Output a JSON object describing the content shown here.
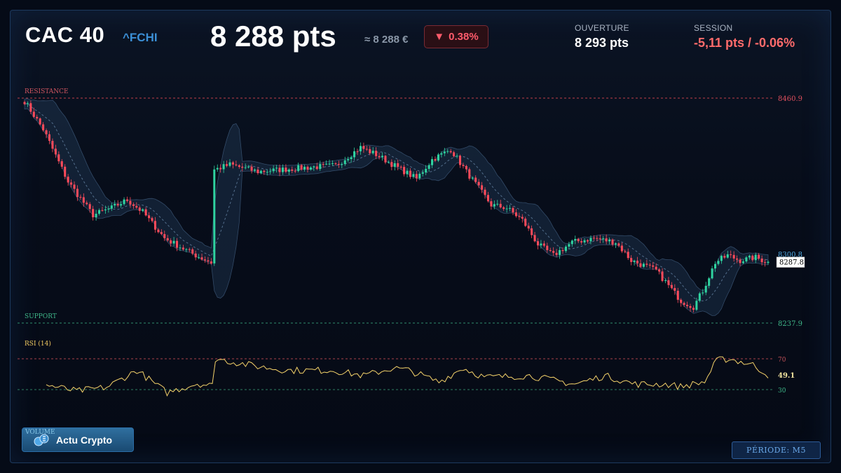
{
  "header": {
    "ticker": "CAC 40",
    "symbol": "^FCHI",
    "price": "8 288 pts",
    "price_eur": "≈ 8 288 €",
    "change_arrow": "▼",
    "change_pct": "0.38%",
    "open_label": "OUVERTURE",
    "open_value": "8 293 pts",
    "session_label": "SESSION",
    "session_value": "-5,11 pts / -0.06%"
  },
  "footer": {
    "volume_label": "VOLUME",
    "crypto_button": "Actu Crypto",
    "period": "PÉRIODE: M5"
  },
  "colors": {
    "up": "#2fd3a0",
    "down": "#ff4a5a",
    "rsi": "#f5d36a",
    "resistance": "#c0404a",
    "support": "#2e8f6e",
    "accent": "#3b8fd6"
  },
  "icons": {
    "crypto": "crypto-coins-icon"
  },
  "chart_data": {
    "type": "candlestick",
    "levels": {
      "resistance_label": "RESISTANCE",
      "resistance": 8460.9,
      "resistance_text": "8460.9",
      "support_label": "SUPPORT",
      "support": 8237.9,
      "support_text": "8237.9",
      "band_upper_text": "8300.8",
      "last_text": "8287.8"
    },
    "ylim": [
      8237.9,
      8460.9
    ],
    "price_path": [
      [
        0,
        8458
      ],
      [
        6,
        8430
      ],
      [
        14,
        8378
      ],
      [
        22,
        8345
      ],
      [
        28,
        8352
      ],
      [
        33,
        8360
      ],
      [
        38,
        8348
      ],
      [
        45,
        8322
      ],
      [
        55,
        8305
      ],
      [
        60,
        8298
      ],
      [
        61,
        8390
      ],
      [
        66,
        8395
      ],
      [
        75,
        8388
      ],
      [
        90,
        8392
      ],
      [
        100,
        8394
      ],
      [
        108,
        8412
      ],
      [
        113,
        8405
      ],
      [
        120,
        8392
      ],
      [
        126,
        8381
      ],
      [
        131,
        8400
      ],
      [
        137,
        8410
      ],
      [
        142,
        8388
      ],
      [
        150,
        8355
      ],
      [
        155,
        8352
      ],
      [
        160,
        8340
      ],
      [
        165,
        8316
      ],
      [
        170,
        8305
      ],
      [
        176,
        8318
      ],
      [
        183,
        8322
      ],
      [
        190,
        8318
      ],
      [
        195,
        8300
      ],
      [
        203,
        8290
      ],
      [
        211,
        8260
      ],
      [
        215,
        8254
      ],
      [
        218,
        8270
      ],
      [
        222,
        8298
      ],
      [
        226,
        8305
      ],
      [
        230,
        8300
      ],
      [
        235,
        8303
      ],
      [
        239,
        8298
      ]
    ],
    "candles": 240,
    "candle_step": 4.46,
    "rsi": {
      "label": "RSI (14)",
      "overbought": 70,
      "overbought_text": "70",
      "oversold": 30,
      "oversold_text": "30",
      "last_text": "49.1",
      "path": [
        [
          0,
          36
        ],
        [
          10,
          28
        ],
        [
          20,
          33
        ],
        [
          30,
          55
        ],
        [
          40,
          26
        ],
        [
          50,
          38
        ],
        [
          55,
          35
        ],
        [
          56,
          70
        ],
        [
          70,
          60
        ],
        [
          80,
          55
        ],
        [
          95,
          55
        ],
        [
          105,
          48
        ],
        [
          115,
          58
        ],
        [
          120,
          55
        ],
        [
          130,
          40
        ],
        [
          138,
          58
        ],
        [
          145,
          46
        ],
        [
          160,
          48
        ],
        [
          175,
          37
        ],
        [
          185,
          48
        ],
        [
          195,
          37
        ],
        [
          205,
          37
        ],
        [
          210,
          34
        ],
        [
          218,
          40
        ],
        [
          222,
          68
        ],
        [
          226,
          70
        ],
        [
          234,
          62
        ],
        [
          239,
          49.1
        ]
      ],
      "ylim": [
        10,
        80
      ]
    }
  }
}
